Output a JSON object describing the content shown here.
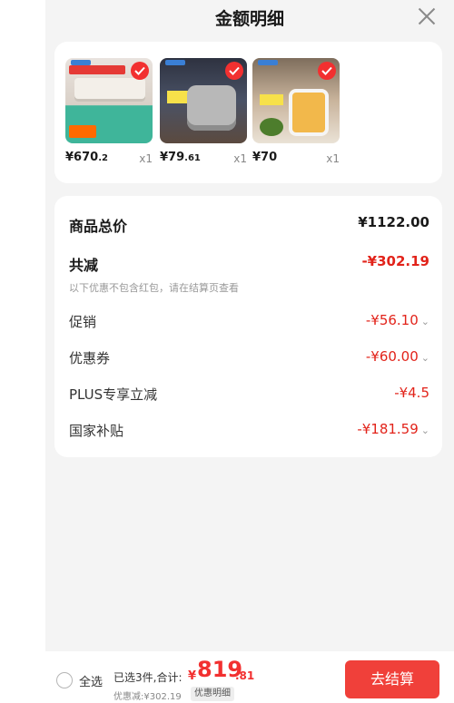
{
  "header": {
    "title": "金额明细"
  },
  "products": [
    {
      "price_int": "¥670",
      "price_dec": ".2",
      "qty": "x1"
    },
    {
      "price_int": "¥79",
      "price_dec": ".61",
      "qty": "x1"
    },
    {
      "price_int": "¥70",
      "price_dec": "",
      "qty": "x1"
    }
  ],
  "summary": {
    "total_label": "商品总价",
    "total_value": "¥1122.00",
    "reduce_label": "共减",
    "reduce_value": "-¥302.19",
    "note": "以下优惠不包含红包，请在结算页查看",
    "lines": [
      {
        "label": "促销",
        "value": "-¥56.10"
      },
      {
        "label": "优惠券",
        "value": "-¥60.00"
      },
      {
        "label": "PLUS专享立减",
        "value": "-¥4.5"
      },
      {
        "label": "国家补贴",
        "value": "-¥181.59"
      }
    ]
  },
  "bottom": {
    "select_all": "全选",
    "selected_text": "已选3件,合计:",
    "total_symbol": "¥",
    "total_int": "819",
    "total_dec": ".81",
    "discount_text": "优惠减:¥302.19",
    "discount_button": "优惠明细",
    "checkout": "去结算"
  },
  "colors": {
    "accent": "#f23030",
    "checkout": "#f0403a",
    "background": "#f4f4f4"
  },
  "icons": {
    "close": "close-icon",
    "check": "check-icon",
    "chevron": "chevron-down-icon"
  }
}
